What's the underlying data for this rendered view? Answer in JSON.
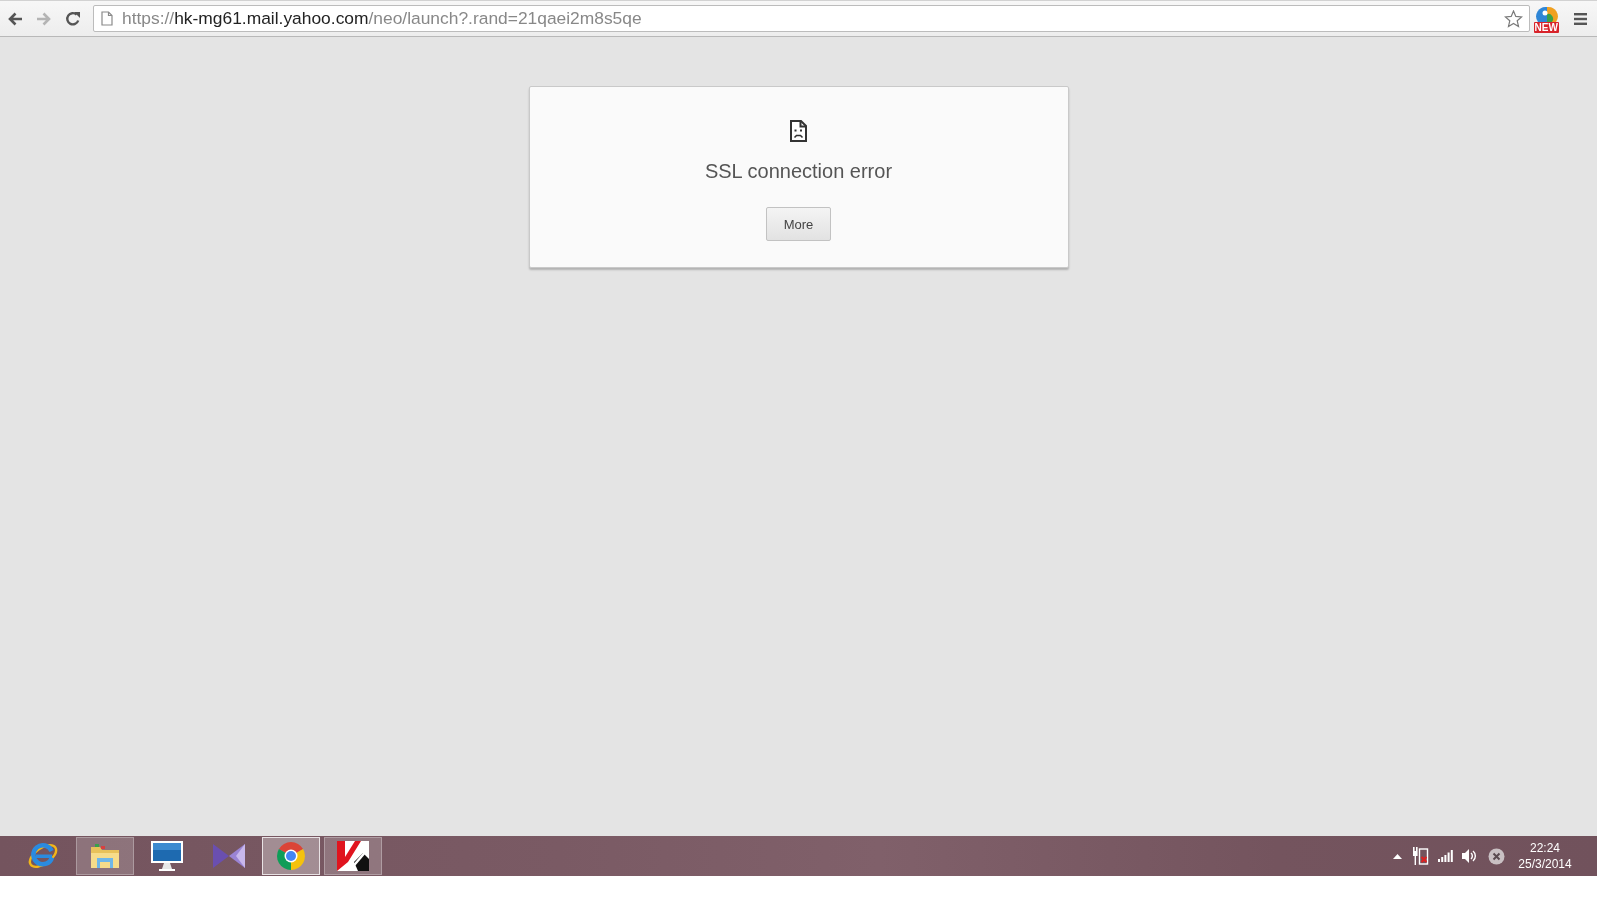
{
  "toolbar": {
    "nav_buttons": [
      {
        "kind": "back",
        "disabled": false
      },
      {
        "kind": "forward",
        "disabled": true
      },
      {
        "kind": "reload",
        "disabled": false
      }
    ],
    "address": {
      "scheme": "https://",
      "host": "hk-mg61.mail.yahoo.com",
      "path": "/neo/launch?.rand=21qaei2m8s5qe"
    },
    "bookmarked": false,
    "extension_badge": "NEW"
  },
  "error_card": {
    "title": "SSL connection error",
    "button": "More"
  },
  "taskbar": {
    "apps": [
      {
        "kind": "ie",
        "running": false,
        "selected": false
      },
      {
        "kind": "explorer",
        "running": true,
        "selected": false
      },
      {
        "kind": "monitor",
        "running": false,
        "selected": false
      },
      {
        "kind": "bowtie",
        "running": false,
        "selected": false
      },
      {
        "kind": "chrome",
        "running": true,
        "selected": true
      },
      {
        "kind": "kaspersky",
        "running": true,
        "selected": false
      }
    ],
    "tray": {
      "time": "22:24",
      "date": "25/3/2014"
    }
  }
}
